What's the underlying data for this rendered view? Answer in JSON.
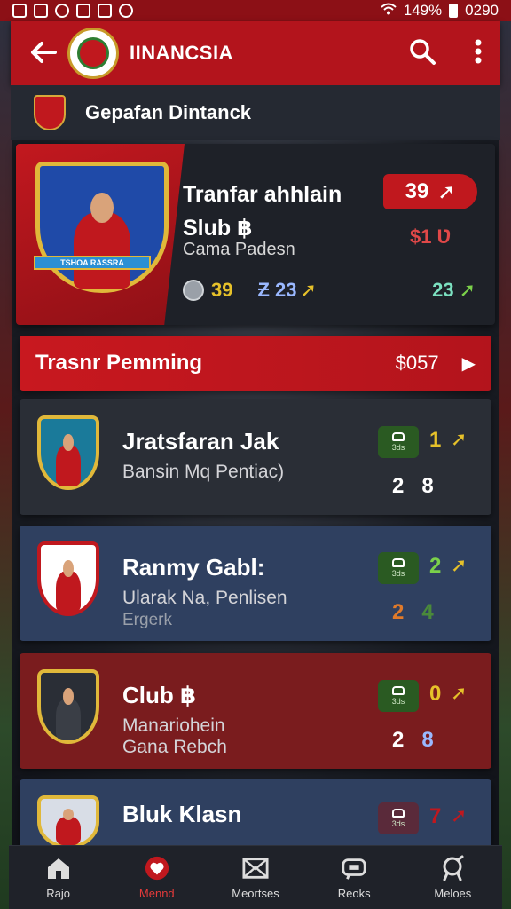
{
  "status_bar": {
    "battery": "149%",
    "time": "0290"
  },
  "app_bar": {
    "title": "IINANCSIA",
    "icons": [
      "back-arrow-icon",
      "search-icon",
      "more-vert-icon"
    ]
  },
  "section": {
    "title": "Gepafan Dintanck"
  },
  "hero": {
    "title_line1": "Tranfar ahhlain",
    "title_line2": "Slub ฿",
    "subtitle": "Cama Padesn",
    "crest_banner": "TSHOA RASSRA",
    "price": "39",
    "value2": "$1 Ʋ",
    "stats": [
      "39",
      "Ƶ 23",
      "23"
    ]
  },
  "transfer_bar": {
    "label": "Trasnr Pemming",
    "amount": "$057"
  },
  "cards": [
    {
      "title": "Jratsfaran Jak",
      "subtitle": "Bansin Mq Pentiac)",
      "note": "",
      "badge_text": "3ds",
      "value1": "1",
      "values2": [
        "2",
        "8"
      ],
      "bg": "#2a2e36",
      "crest_color": "#1a7a9a"
    },
    {
      "title": "Ranmy Gabl:",
      "subtitle": "Ularak Na, Penlisen",
      "note": "Ergerk",
      "badge_text": "3ds",
      "value1": "2",
      "values2": [
        "2",
        "4"
      ],
      "bg": "#2f4060",
      "crest_color": "#c0181e"
    },
    {
      "title": "Club ฿",
      "subtitle": "Manariohein",
      "note": "Gana Rebch",
      "badge_text": "3ds",
      "value1": "0",
      "values2": [
        "2",
        "8"
      ],
      "bg": "#7a1c1e",
      "crest_color": "#2a2e36"
    },
    {
      "title": "Bluk Klasn",
      "subtitle": "",
      "note": "",
      "badge_text": "3ds",
      "value1": "7",
      "values2": [],
      "bg": "#2f4060",
      "crest_color": "#d8dde6"
    }
  ],
  "bottom_nav": [
    {
      "label": "Rajo",
      "icon": "home-icon",
      "active": false
    },
    {
      "label": "Mennd",
      "icon": "heart-icon",
      "active": true
    },
    {
      "label": "Meortses",
      "icon": "mail-icon",
      "active": false
    },
    {
      "label": "Reoks",
      "icon": "chat-icon",
      "active": false
    },
    {
      "label": "Meloes",
      "icon": "trophy-icon",
      "active": false
    }
  ],
  "colors": {
    "brand_red": "#b3141c",
    "accent_green": "#7bd14a",
    "accent_yellow": "#e6c12a"
  }
}
